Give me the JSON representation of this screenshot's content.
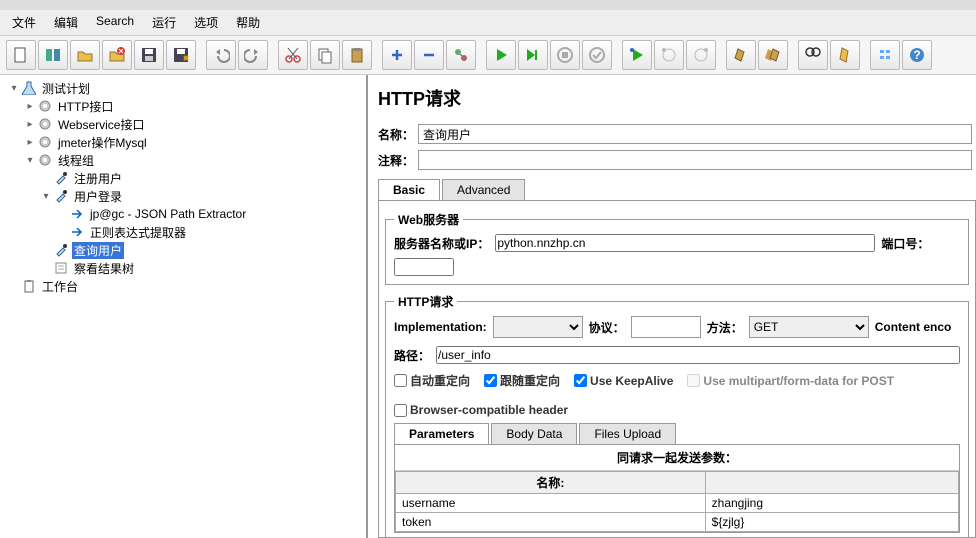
{
  "menu": {
    "file": "文件",
    "edit": "编辑",
    "search": "Search",
    "run": "运行",
    "options": "选项",
    "help": "帮助"
  },
  "tree": {
    "plan": "测试计划",
    "http_iface": "HTTP接口",
    "ws_iface": "Webservice接口",
    "mysql": "jmeter操作Mysql",
    "thread": "线程组",
    "register": "注册用户",
    "login": "用户登录",
    "jsonext": "jp@gc - JSON Path Extractor",
    "regex": "正则表达式提取器",
    "query": "查询用户",
    "viewtree": "察看结果树",
    "workbench": "工作台"
  },
  "panel": {
    "title": "HTTP请求",
    "name_label": "名称：",
    "name_value": "查询用户",
    "comment_label": "注释：",
    "tab_basic": "Basic",
    "tab_advanced": "Advanced",
    "fs_web": "Web服务器",
    "server_label": "服务器名称或IP：",
    "server_value": "python.nnzhp.cn",
    "port_label": "端口号：",
    "fs_http": "HTTP请求",
    "impl_label": "Implementation:",
    "proto_label": "协议：",
    "method_label": "方法：",
    "method_value": "GET",
    "enc_label": "Content enco",
    "path_label": "路径：",
    "path_value": "/user_info",
    "cb_auto": "自动重定向",
    "cb_follow": "跟随重定向",
    "cb_keepalive": "Use KeepAlive",
    "cb_multipart": "Use multipart/form-data for POST",
    "cb_compat": "Browser-compatible header",
    "subtab_params": "Parameters",
    "subtab_body": "Body Data",
    "subtab_files": "Files Upload",
    "params_hdr": "同请求一起发送参数：",
    "col_name": "名称:",
    "rows": [
      {
        "name": "username",
        "value": "zhangjing"
      },
      {
        "name": "token",
        "value": "${zjlg}"
      }
    ]
  }
}
